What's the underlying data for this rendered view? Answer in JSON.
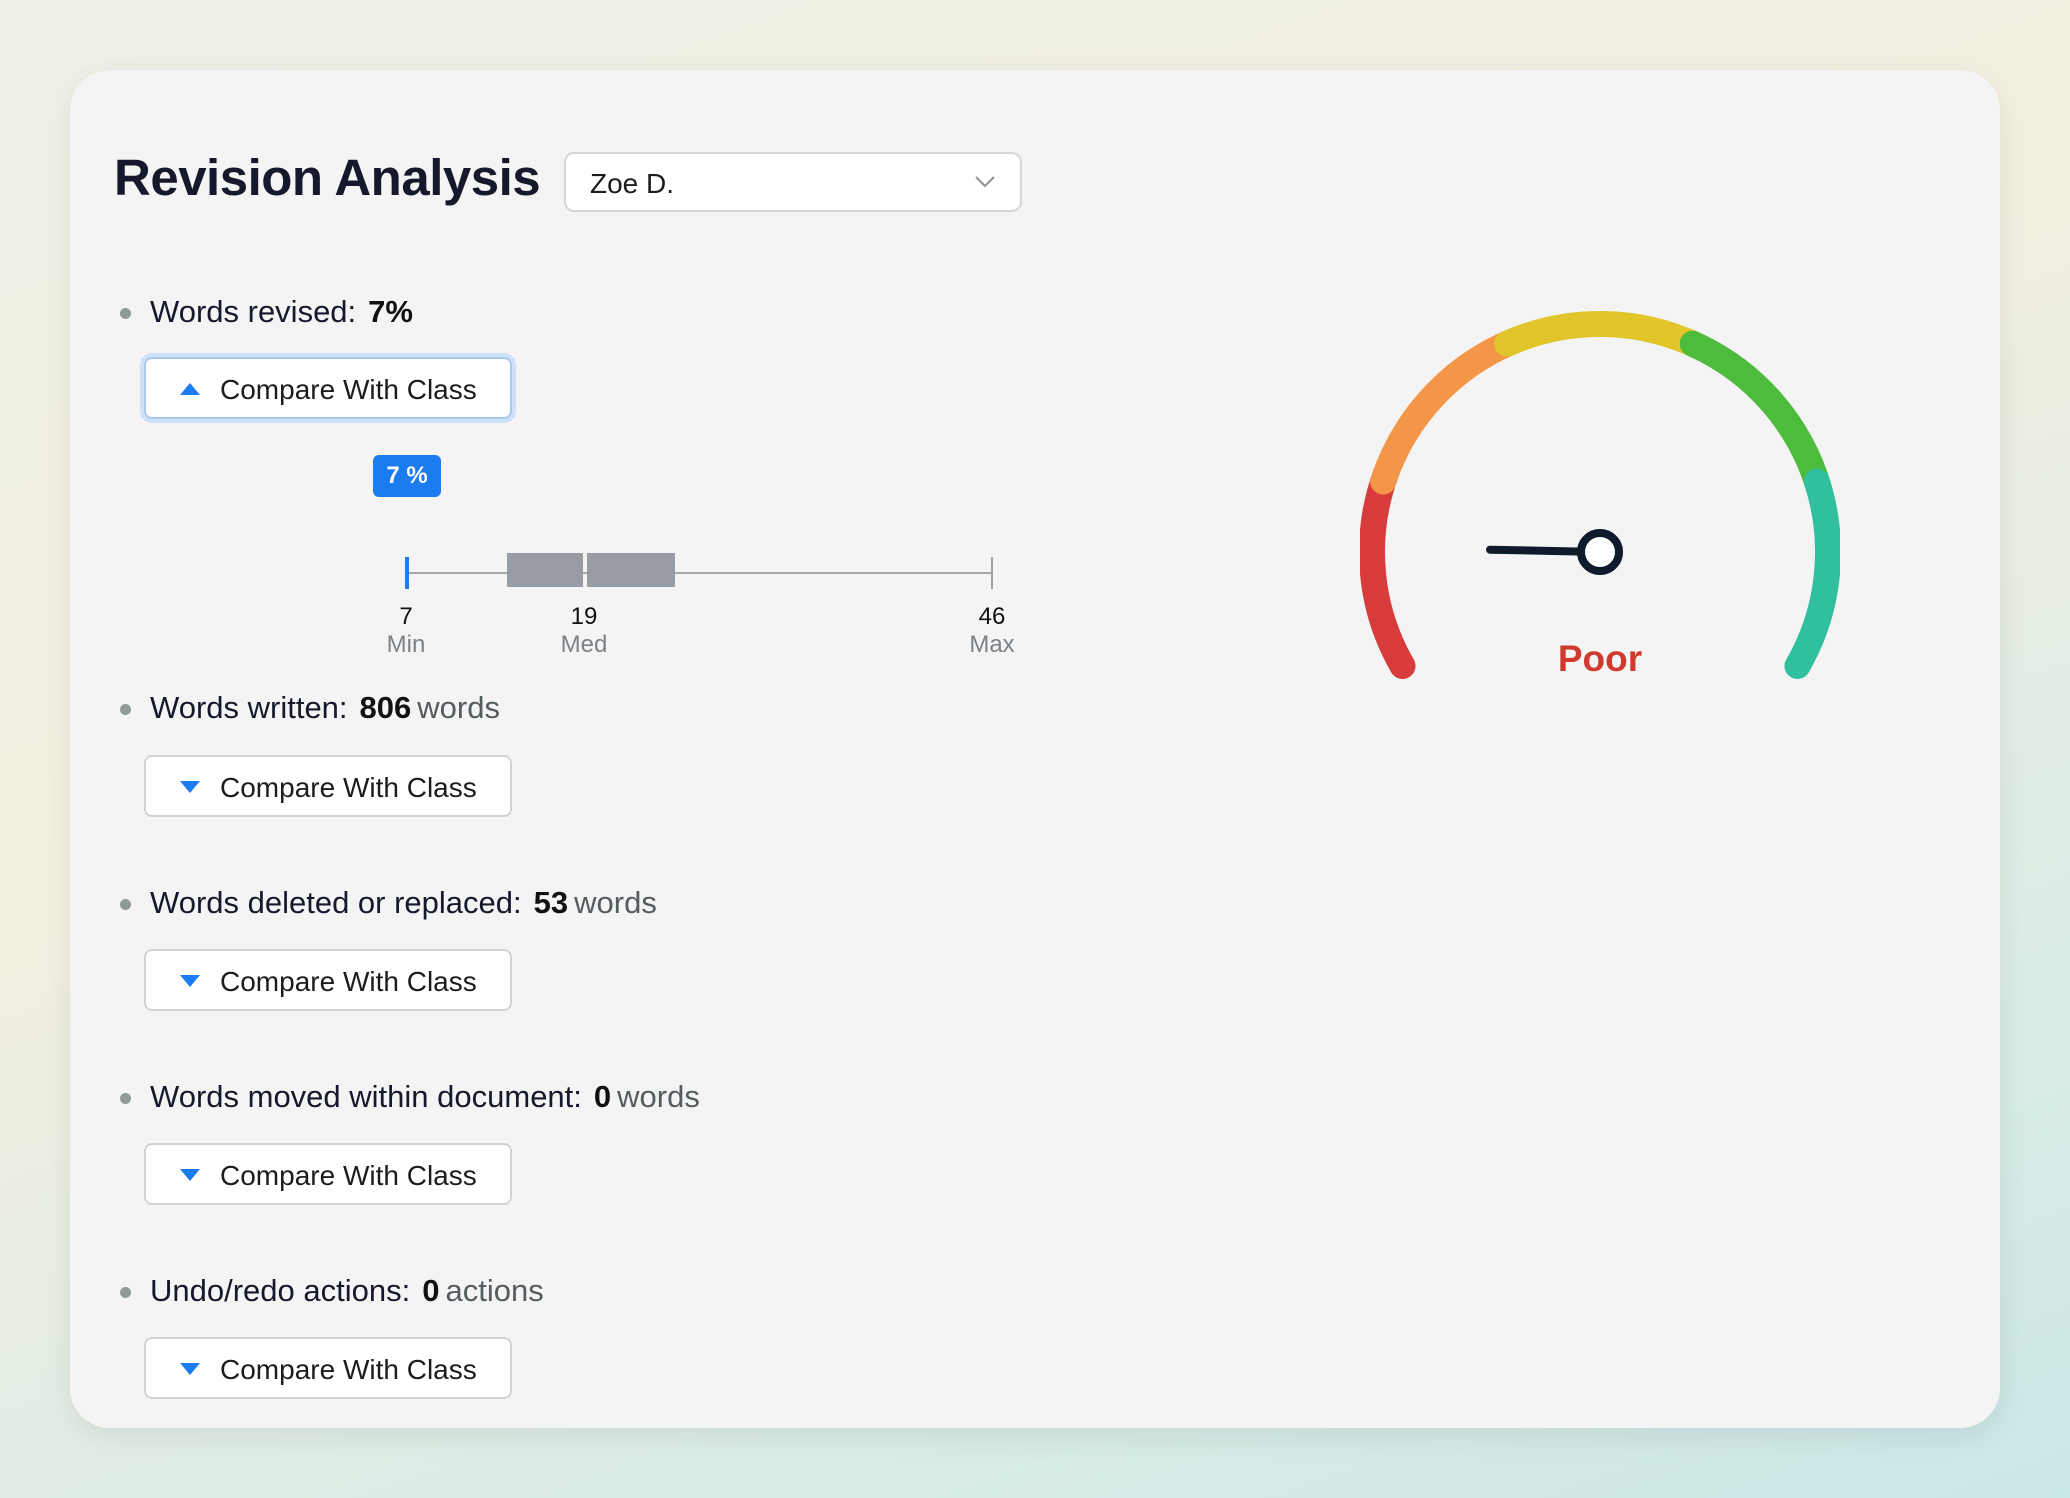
{
  "header": {
    "title": "Revision Analysis",
    "student_select": {
      "value": "Zoe D."
    }
  },
  "metrics": [
    {
      "label": "Words revised:",
      "value": "7%",
      "unit": "",
      "compare_label": "Compare With Class",
      "expanded": true
    },
    {
      "label": "Words written:",
      "value": "806",
      "unit": "words",
      "compare_label": "Compare With Class",
      "expanded": false
    },
    {
      "label": "Words deleted or replaced:",
      "value": "53",
      "unit": "words",
      "compare_label": "Compare With Class",
      "expanded": false
    },
    {
      "label": "Words moved within document:",
      "value": "0",
      "unit": "words",
      "compare_label": "Compare With Class",
      "expanded": false
    },
    {
      "label": "Undo/redo actions:",
      "value": "0",
      "unit": "actions",
      "compare_label": "Compare With Class",
      "expanded": false
    }
  ],
  "class_comparison": {
    "student_badge": "7 %",
    "student_value": 7,
    "min": {
      "value": "7",
      "label": "Min"
    },
    "median": {
      "value": "19",
      "label": "Med"
    },
    "max": {
      "value": "46",
      "label": "Max"
    },
    "q1": 13,
    "q3": 28
  },
  "gauge": {
    "rating": "Poor",
    "needle_fraction": 0.13,
    "segment_colors": [
      "#d83b3b",
      "#f49648",
      "#e2c52a",
      "#4dbb3c",
      "#31c09d"
    ],
    "rating_color": "#d03a2e"
  },
  "colors": {
    "accent": "#1a7cf0",
    "title": "#15192b",
    "card_bg": "#f4f4f4"
  }
}
